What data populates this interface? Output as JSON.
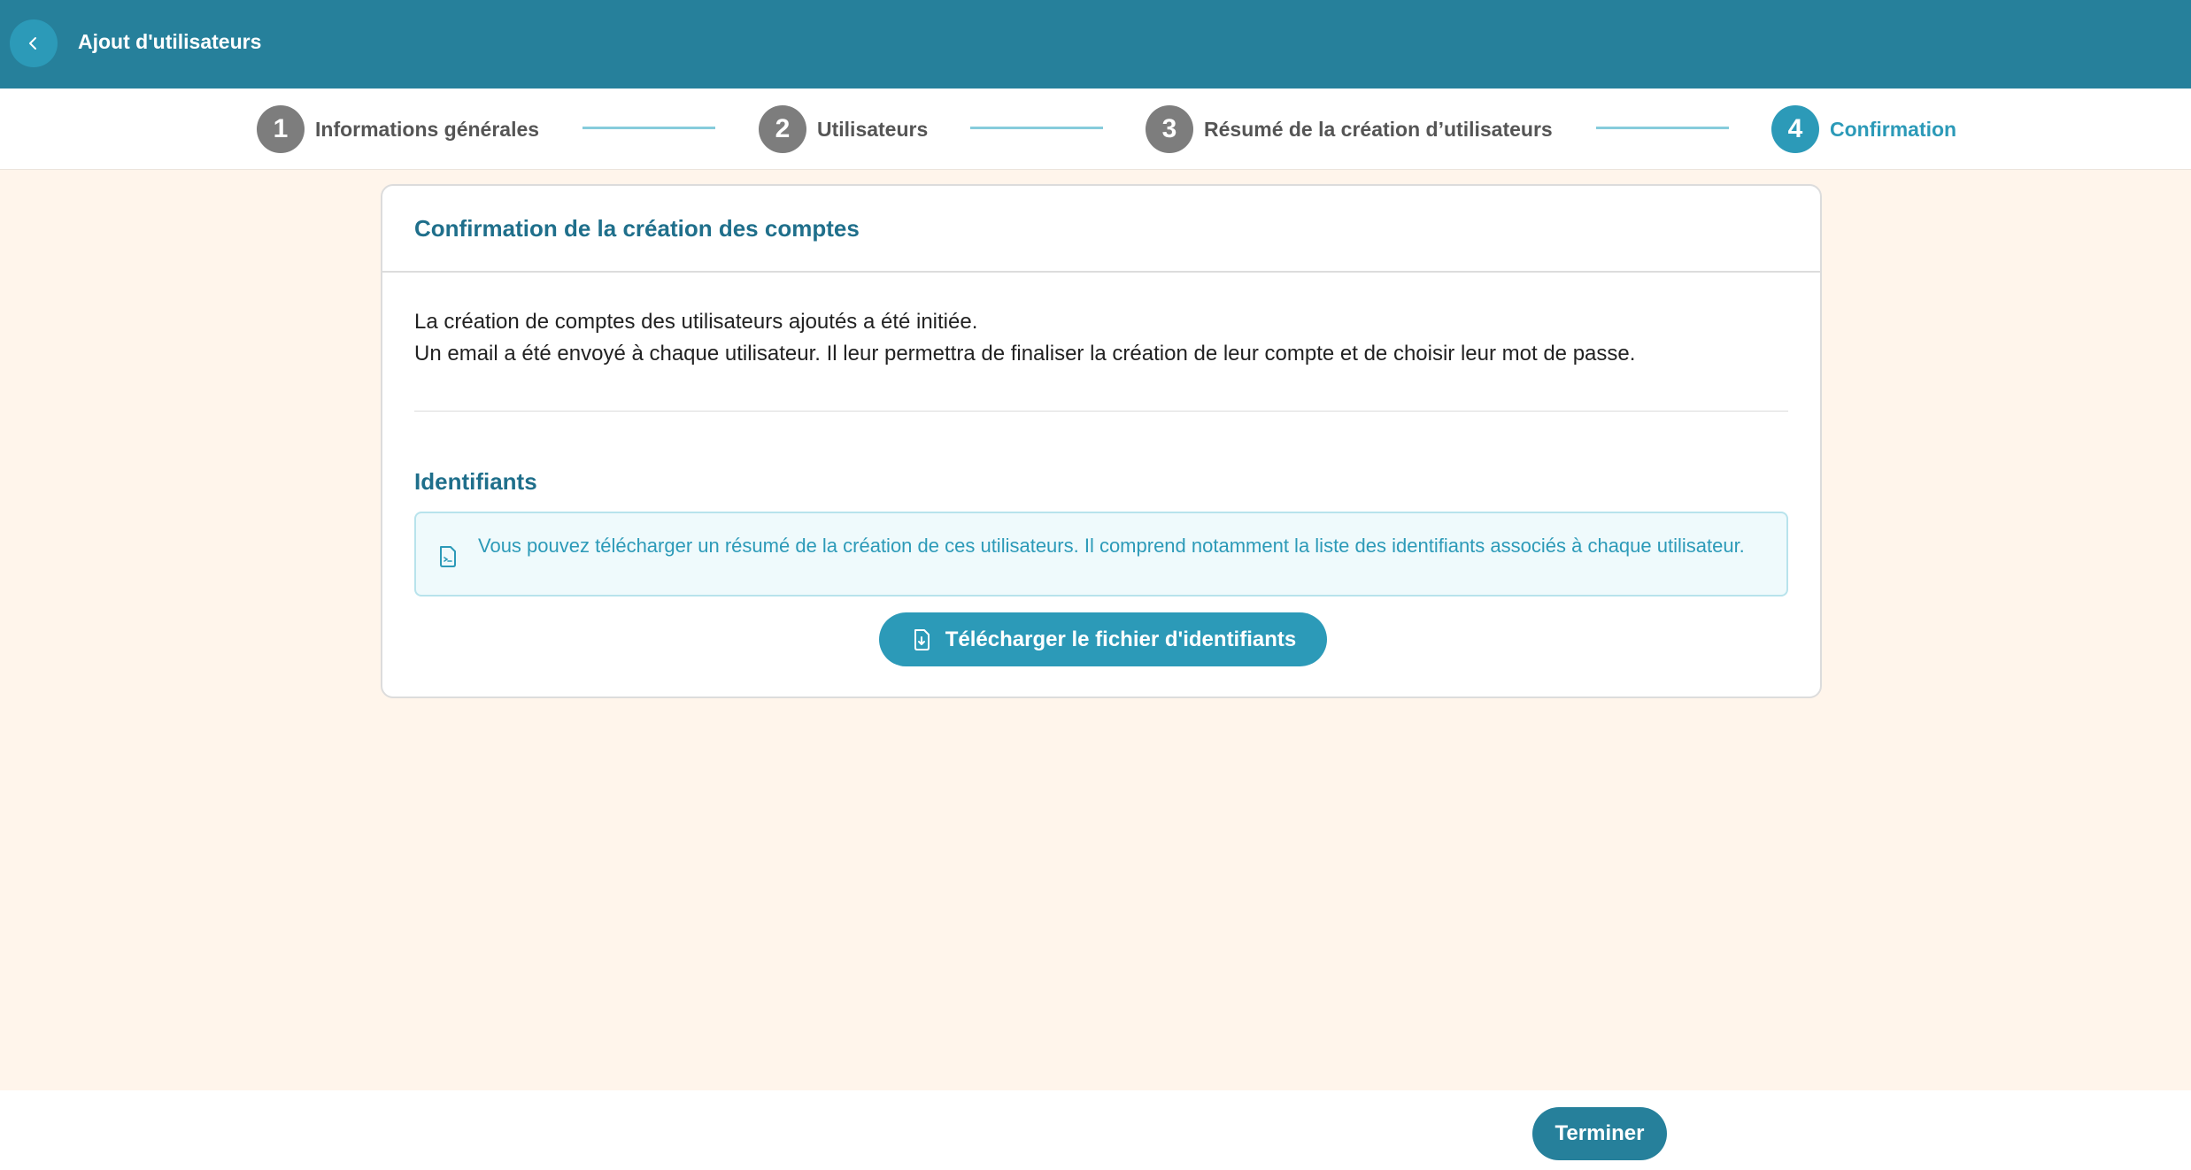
{
  "header": {
    "title": "Ajout d'utilisateurs",
    "back_icon": "chevron-left-icon"
  },
  "stepper": {
    "steps": [
      {
        "number": "1",
        "label": "Informations générales",
        "state": "completed"
      },
      {
        "number": "2",
        "label": "Utilisateurs",
        "state": "completed"
      },
      {
        "number": "3",
        "label": "Résumé de la création d’utilisateurs",
        "state": "completed"
      },
      {
        "number": "4",
        "label": "Confirmation",
        "state": "active"
      }
    ]
  },
  "card": {
    "title": "Confirmation de la création des comptes",
    "line1": "La création de comptes des utilisateurs ajoutés a été initiée.",
    "line2": "Un email a été envoyé à chaque utilisateur. Il leur permettra de finaliser la création de leur compte et de choisir leur mot de passe.",
    "section_title": "Identifiants",
    "info_icon": "document-icon",
    "info_text": "Vous pouvez télécharger un résumé de la création de ces utilisateurs. Il comprend notamment la liste des identifiants associés à chaque utilisateur.",
    "download_icon": "download-file-icon",
    "download_label": "Télécharger le fichier d'identifiants"
  },
  "footer": {
    "finish_label": "Terminer"
  },
  "colors": {
    "header_bg": "#26809b",
    "accent": "#2c9ab8",
    "page_bg": "#fff5eb",
    "inactive_step": "#7d7d7d"
  }
}
